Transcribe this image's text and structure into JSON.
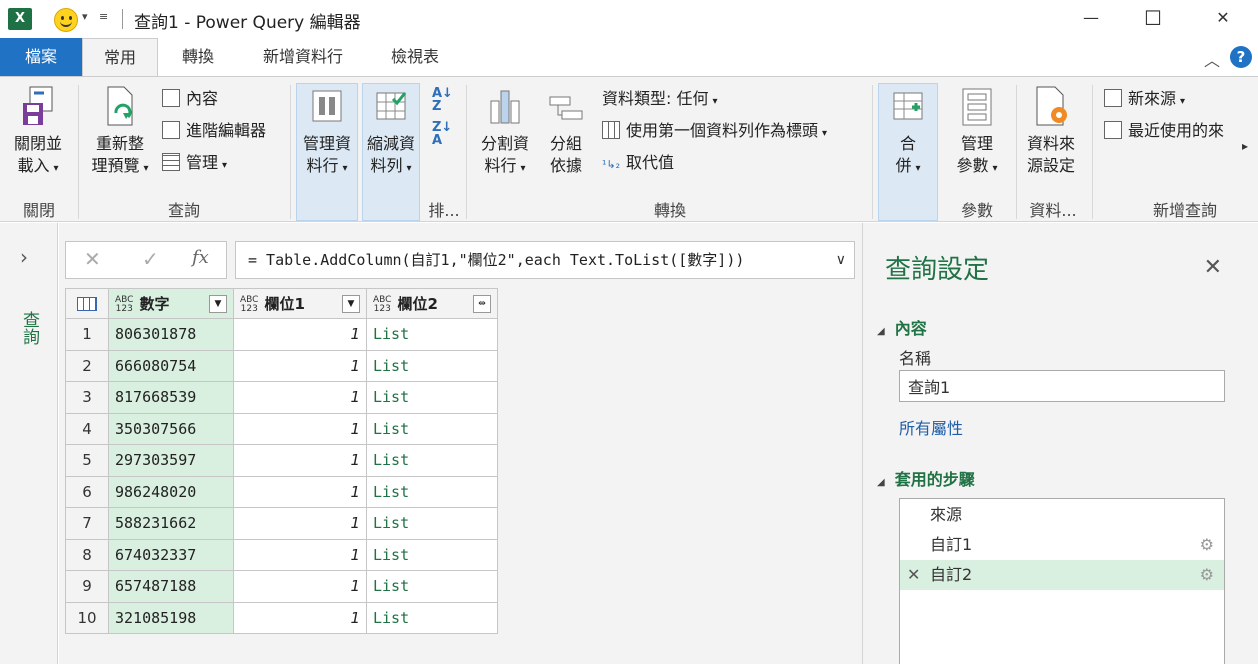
{
  "window": {
    "title": "查詢1 - Power Query 編輯器",
    "app_icon_letter": "X",
    "minimize_icon": "—",
    "maximize_icon": "☐",
    "close_icon": "✕"
  },
  "tabs": [
    {
      "label": "檔案"
    },
    {
      "label": "常用"
    },
    {
      "label": "轉換"
    },
    {
      "label": "新增資料行"
    },
    {
      "label": "檢視表"
    }
  ],
  "help_label": "?",
  "ribbon": {
    "close_load": {
      "line1": "關閉並",
      "line2": "載入"
    },
    "refresh": {
      "line1": "重新整",
      "line2": "理預覽"
    },
    "properties": "內容",
    "advanced_editor": "進階編輯器",
    "manage": "管理",
    "manage_columns": {
      "line1": "管理資",
      "line2": "料行"
    },
    "reduce_rows": {
      "line1": "縮減資",
      "line2": "料列"
    },
    "split_column": {
      "line1": "分割資",
      "line2": "料行"
    },
    "group_by": {
      "line1": "分組",
      "line2": "依據"
    },
    "data_type": "資料類型: 任何",
    "use_first_row": "使用第一個資料列作為標頭",
    "replace_values": "取代值",
    "merge": {
      "line1": "合",
      "line2": "併"
    },
    "manage_params": {
      "line1": "管理",
      "line2": "參數"
    },
    "data_source_settings": {
      "line1": "資料來",
      "line2": "源設定"
    },
    "new_source": "新來源",
    "recent_sources": "最近使用的來",
    "groups": {
      "close": "關閉",
      "query": "查詢",
      "sort": "排...",
      "transform": "轉換",
      "params": "參數",
      "datasource": "資料...",
      "new_query": "新增查詢"
    }
  },
  "queries_pane_label": "查詢",
  "formula": "= Table.AddColumn(自訂1,\"欄位2\",each Text.ToList([數字]))",
  "grid": {
    "type_badge": {
      "top": "ABC",
      "bottom": "123"
    },
    "columns": [
      "數字",
      "欄位1",
      "欄位2"
    ],
    "rows": [
      {
        "n": "1",
        "num": "806301878",
        "f1": "1",
        "f2": "List"
      },
      {
        "n": "2",
        "num": "666080754",
        "f1": "1",
        "f2": "List"
      },
      {
        "n": "3",
        "num": "817668539",
        "f1": "1",
        "f2": "List"
      },
      {
        "n": "4",
        "num": "350307566",
        "f1": "1",
        "f2": "List"
      },
      {
        "n": "5",
        "num": "297303597",
        "f1": "1",
        "f2": "List"
      },
      {
        "n": "6",
        "num": "986248020",
        "f1": "1",
        "f2": "List"
      },
      {
        "n": "7",
        "num": "588231662",
        "f1": "1",
        "f2": "List"
      },
      {
        "n": "8",
        "num": "674032337",
        "f1": "1",
        "f2": "List"
      },
      {
        "n": "9",
        "num": "657487188",
        "f1": "1",
        "f2": "List"
      },
      {
        "n": "10",
        "num": "321085198",
        "f1": "1",
        "f2": "List"
      }
    ]
  },
  "settings": {
    "title": "查詢設定",
    "properties_header": "內容",
    "name_label": "名稱",
    "name_value": "查詢1",
    "all_properties": "所有屬性",
    "steps_header": "套用的步驟",
    "steps": [
      "來源",
      "自訂1",
      "自訂2"
    ]
  },
  "colors": {
    "accent_green": "#217346",
    "file_tab_blue": "#1f72c4",
    "selected_row_green": "#d9efe0"
  }
}
